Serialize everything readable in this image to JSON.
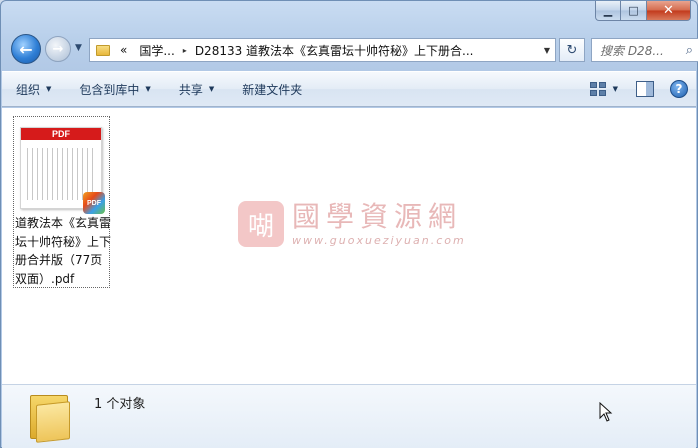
{
  "window": {
    "caption_buttons": {
      "minimize": "▁",
      "maximize": "□",
      "close": "✕"
    }
  },
  "nav": {
    "back_glyph": "←",
    "forward_glyph": "→",
    "history_glyph": "▼",
    "address": {
      "overflow": "«",
      "segments": [
        "国学...",
        "D28133 道教法本《玄真雷坛十帅符秘》上下册合..."
      ],
      "separator": "▸",
      "dropdown_glyph": "▼"
    },
    "refresh_glyph": "↻",
    "search": {
      "placeholder": "搜索 D28...",
      "icon": "search-icon"
    }
  },
  "toolbar": {
    "organize": "组织",
    "include_in_library": "包含到库中",
    "share": "共享",
    "new_folder": "新建文件夹",
    "caret": "▼",
    "help": "?"
  },
  "files": [
    {
      "thumb_label": "PDF",
      "badge": "PDF",
      "name": "道教法本《玄真雷坛十帅符秘》上下册合并版（77页双面）.pdf"
    }
  ],
  "watermark": {
    "seal": "㗅",
    "title": "國學資源網",
    "url": "www.guoxueziyuan.com"
  },
  "status": {
    "object_count": "1 个对象"
  },
  "colors": {
    "window_frame": "#b8cfea",
    "command_bar": "#dfe9f5",
    "pdf_red": "#d61b1b",
    "watermark": "#e8b8b8"
  }
}
